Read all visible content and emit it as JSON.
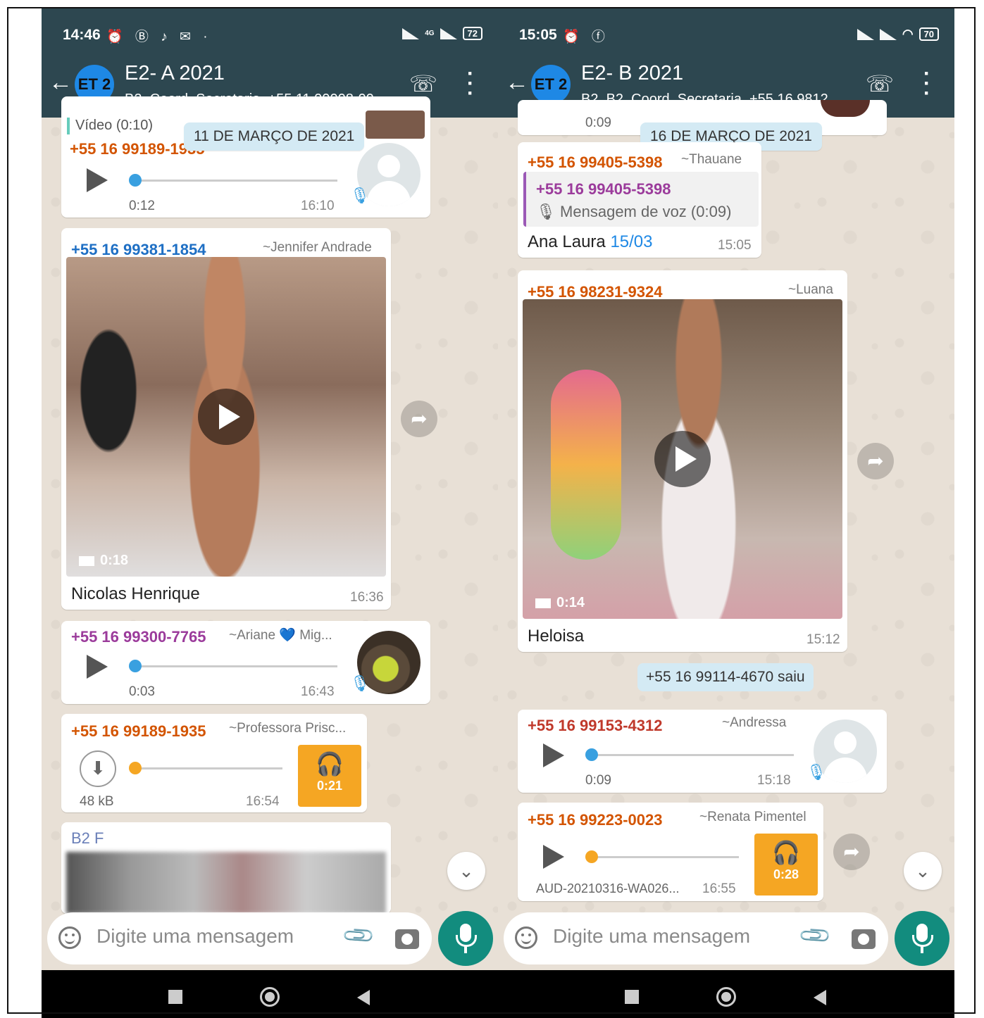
{
  "left": {
    "status": {
      "time": "14:46",
      "icons": "⏰ Ⓑ ♪ ✉ ·",
      "network": "4G",
      "battery": "72"
    },
    "header": {
      "avatar": "ET 2",
      "title": "E2- A 2021",
      "subtitle": "B2, Coord, Secretaria, +55 11 99008-00..."
    },
    "top_partial": {
      "text": "Vídeo (0:10)",
      "sender": "+55 16 99189-1935",
      "position": "0:12",
      "time": "16:10"
    },
    "date_chip": "11 DE MARÇO DE 2021",
    "msg1": {
      "sender": "+55 16 99381-1854",
      "alias": "~Jennifer Andrade",
      "duration": "0:18",
      "caption": "Nicolas Henrique",
      "time": "16:36"
    },
    "msg2": {
      "sender": "+55 16 99300-7765",
      "alias": "~Ariane 💙 Mig...",
      "position": "0:03",
      "time": "16:43"
    },
    "msg3": {
      "sender": "+55 16 99189-1935",
      "alias": "~Professora Prisc...",
      "size": "48 kB",
      "time": "16:54",
      "duration": "0:21"
    },
    "msg4": {
      "sender": "B2 F"
    },
    "input": {
      "placeholder": "Digite uma mensagem"
    }
  },
  "right": {
    "status": {
      "time": "15:05",
      "icons": "⏰ ⓕ",
      "battery": "70"
    },
    "header": {
      "avatar": "ET 2",
      "title": "E2- B 2021",
      "subtitle": "B2, B2, Coord, Secretaria, +55 16 9812..."
    },
    "top_partial": {
      "position": "0:09"
    },
    "date_chip": "16 DE MARÇO DE 2021",
    "msg1": {
      "sender": "+55 16 99405-5398",
      "alias": "~Thauane",
      "quote_sender": "+55 16 99405-5398",
      "quote_text": "Mensagem de voz (0:09)",
      "caption_name": "Ana Laura",
      "caption_date": "15/03",
      "time": "15:05"
    },
    "msg2": {
      "sender": "+55 16 98231-9324",
      "alias": "~Luana",
      "duration": "0:14",
      "caption": "Heloisa",
      "time": "15:12"
    },
    "system": "+55 16 99114-4670 saiu",
    "msg3": {
      "sender": "+55 16 99153-4312",
      "alias": "~Andressa",
      "position": "0:09",
      "time": "15:18"
    },
    "msg4": {
      "sender": "+55 16 99223-0023",
      "alias": "~Renata Pimentel",
      "filename": "AUD-20210316-WA026...",
      "time": "16:55",
      "duration": "0:28"
    },
    "input": {
      "placeholder": "Digite uma mensagem"
    }
  },
  "colors": {
    "header": "#2d4750",
    "accent": "#128c7e",
    "audio_orange": "#f5a623",
    "voice_blue": "#39a0e0"
  }
}
